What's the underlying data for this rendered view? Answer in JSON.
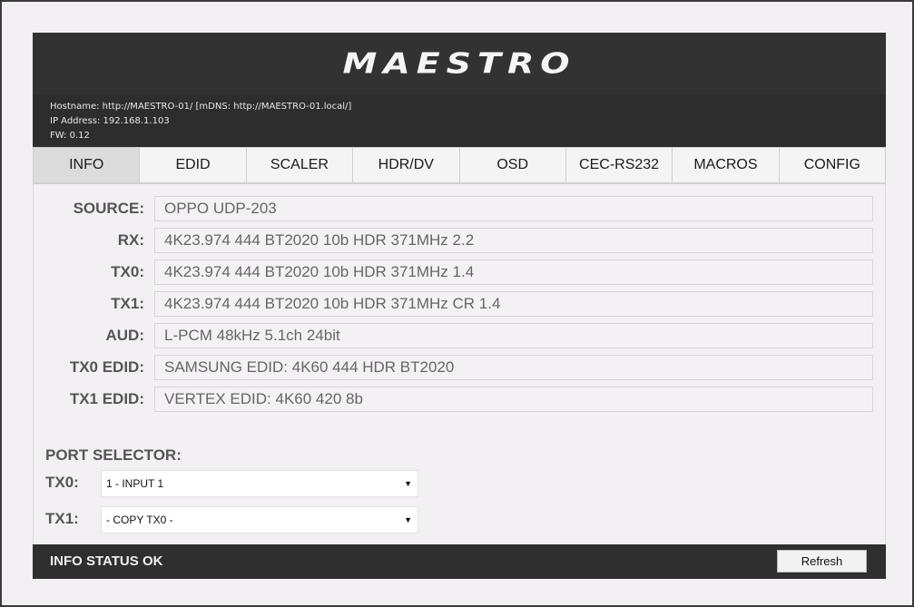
{
  "header": {
    "logo_text": "MAESTRO",
    "hostname_line": "Hostname: http://MAESTRO-01/ [mDNS: http://MAESTRO-01.local/]",
    "ip_line": "IP Address: 192.168.1.103",
    "fw_line": "FW: 0.12"
  },
  "tabs": [
    {
      "label": "INFO",
      "active": true
    },
    {
      "label": "EDID"
    },
    {
      "label": "SCALER"
    },
    {
      "label": "HDR/DV"
    },
    {
      "label": "OSD"
    },
    {
      "label": "CEC-RS232"
    },
    {
      "label": "MACROS"
    },
    {
      "label": "CONFIG"
    }
  ],
  "info": {
    "rows": [
      {
        "label": "SOURCE:",
        "value": "OPPO UDP-203"
      },
      {
        "label": "RX:",
        "value": "4K23.974 444 BT2020 10b HDR 371MHz 2.2"
      },
      {
        "label": "TX0:",
        "value": "4K23.974 444 BT2020 10b HDR 371MHz 1.4"
      },
      {
        "label": "TX1:",
        "value": "4K23.974 444 BT2020 10b HDR 371MHz CR 1.4"
      },
      {
        "label": "AUD:",
        "value": "L-PCM 48kHz 5.1ch 24bit"
      },
      {
        "label": "TX0 EDID:",
        "value": "SAMSUNG EDID: 4K60 444 HDR BT2020"
      },
      {
        "label": "TX1 EDID:",
        "value": "VERTEX EDID: 4K60 420 8b"
      }
    ]
  },
  "port_selector": {
    "title": "PORT SELECTOR:",
    "tx0": {
      "label": "TX0:",
      "selected": "1 - INPUT 1"
    },
    "tx1": {
      "label": "TX1:",
      "selected": "- COPY TX0 -"
    }
  },
  "status": {
    "text": "INFO STATUS OK",
    "refresh_label": "Refresh"
  },
  "colors": {
    "header_bg": "#2d2d2d",
    "page_bg": "#f2f0f3",
    "active_tab_bg": "#dcdcdc"
  },
  "icons": {
    "select_arrow": "dropdown-arrow-icon"
  }
}
